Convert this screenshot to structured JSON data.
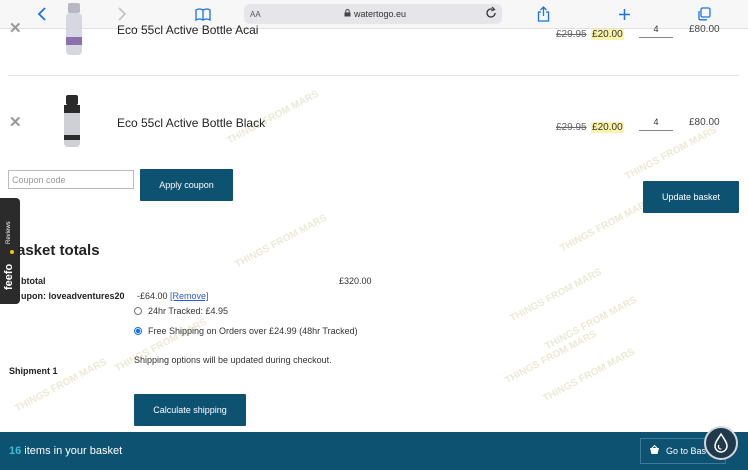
{
  "browser": {
    "text_size": "AA",
    "url": "watertogo.eu"
  },
  "cart": {
    "items": [
      {
        "name": "Eco 55cl Active Bottle Acai",
        "price_old": "£29.95",
        "price_new": "£20.00",
        "quantity": "4",
        "total": "£80.00",
        "bottle_color": "#8b6fae"
      },
      {
        "name": "Eco 55cl Active Bottle Black",
        "price_old": "£29.95",
        "price_new": "£20.00",
        "quantity": "4",
        "total": "£80.00",
        "bottle_color": "#2b2b2b"
      }
    ],
    "coupon_placeholder": "Coupon code",
    "apply_coupon": "Apply coupon",
    "update_basket": "Update basket"
  },
  "totals": {
    "heading": "asket totals",
    "subtotal_label": "btotal",
    "subtotal_value": "£320.00",
    "coupon_label": "upon: loveadventures20",
    "coupon_value": "-£64.00",
    "coupon_remove": "[Remove]",
    "shipping_options": [
      {
        "label": "24hr Tracked: £4.95",
        "selected": false
      },
      {
        "label": "Free Shipping on Orders over £24.99 (48hr Tracked)",
        "selected": true
      }
    ],
    "shipment_label": "Shipment 1",
    "shipping_note": "Shipping options will be updated during checkout.",
    "calculate_shipping": "Calculate shipping"
  },
  "feefo": {
    "brand": "feefo",
    "reviews": "Reviews"
  },
  "footer": {
    "count": "16",
    "items_text": " items in your basket",
    "go_button": "Go to Bas"
  },
  "watermark": "THINGS FROM MARS",
  "colors": {
    "brand_blue": "#0e5272",
    "footer_count": "#33c0d8",
    "sale_highlight": "#fbf3a8",
    "link": "#2a5bd8"
  }
}
